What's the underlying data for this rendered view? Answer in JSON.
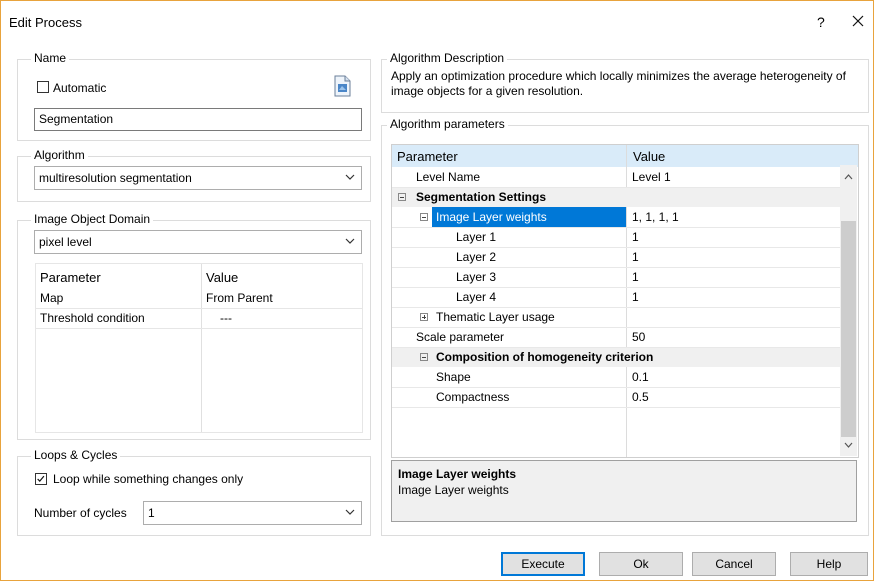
{
  "window": {
    "title": "Edit Process",
    "help_glyph": "?",
    "close_icon": "close-x-icon"
  },
  "name_group": {
    "label": "Name",
    "automatic_label": "Automatic",
    "automatic_checked": false,
    "name_value": "Segmentation",
    "edit_icon": "document-edit-icon"
  },
  "algorithm_group": {
    "label": "Algorithm",
    "selected": "multiresolution segmentation"
  },
  "domain_group": {
    "label": "Image Object Domain",
    "selected": "pixel level",
    "headers": {
      "parameter": "Parameter",
      "value": "Value"
    },
    "rows": [
      {
        "parameter": "Map",
        "value": "From Parent"
      },
      {
        "parameter": "Threshold condition",
        "value": "---"
      }
    ]
  },
  "loops_group": {
    "label": "Loops & Cycles",
    "loop_label": "Loop while something changes only",
    "loop_checked": true,
    "cycles_label": "Number of cycles",
    "cycles_value": "1"
  },
  "description_group": {
    "label": "Algorithm Description",
    "text": "Apply an optimization procedure which locally minimizes the average heterogeneity of image objects for a given resolution."
  },
  "params_group": {
    "label": "Algorithm parameters",
    "headers": {
      "parameter": "Parameter",
      "value": "Value"
    },
    "rows": [
      {
        "name": "Level Name",
        "value": "Level 1"
      },
      {
        "name": "Segmentation Settings",
        "value": ""
      },
      {
        "name": "Image Layer weights",
        "value": "1, 1, 1, 1"
      },
      {
        "name": "Layer 1",
        "value": "1"
      },
      {
        "name": "Layer 2",
        "value": "1"
      },
      {
        "name": "Layer 3",
        "value": "1"
      },
      {
        "name": "Layer 4",
        "value": "1"
      },
      {
        "name": "Thematic Layer usage",
        "value": ""
      },
      {
        "name": "Scale parameter",
        "value": "50"
      },
      {
        "name": "Composition of homogeneity criterion",
        "value": ""
      },
      {
        "name": "Shape",
        "value": "0.1"
      },
      {
        "name": "Compactness",
        "value": "0.5"
      }
    ],
    "selected_row": "Image Layer weights",
    "help_title": "Image Layer weights",
    "help_text": "Image Layer weights"
  },
  "buttons": {
    "execute": "Execute",
    "ok": "Ok",
    "cancel": "Cancel",
    "help": "Help"
  },
  "colors": {
    "selection": "#0078d7",
    "header_bg": "#d9ebf9",
    "category_bg": "#f0f0f0",
    "window_border": "#e8a33d"
  }
}
